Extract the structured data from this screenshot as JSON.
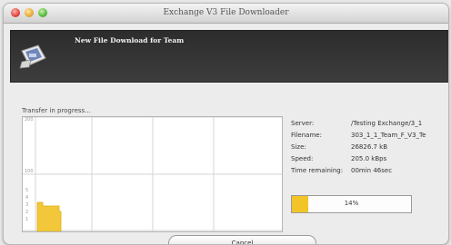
{
  "window": {
    "title": "Exchange V3 File Downloader"
  },
  "banner": {
    "heading": "New File Download for Team"
  },
  "transfer": {
    "status_label": "Transfer in progress...",
    "graph": {
      "axis_values": [
        "200",
        "100",
        "5",
        "4",
        "3",
        "2",
        "1"
      ],
      "filled_fraction_of_height": 0.22,
      "filled_fraction_of_width": 0.09
    }
  },
  "details": {
    "server_label": "Server:",
    "server_value": "/Testing Exchange/3_1",
    "filename_label": "Filename:",
    "filename_value": "303_1_1_Team_F_V3_Te",
    "size_label": "Size:",
    "size_value": "26826.7 kB",
    "speed_label": "Speed:",
    "speed_value": "205.0 kBps",
    "time_label": "Time remaining:",
    "time_value": "00min 46sec"
  },
  "progress": {
    "percent": 14,
    "label": "14%"
  },
  "buttons": {
    "cancel_label": "Cancel"
  },
  "colors": {
    "accent": "#f2c428",
    "banner": "#2c2c2c"
  }
}
